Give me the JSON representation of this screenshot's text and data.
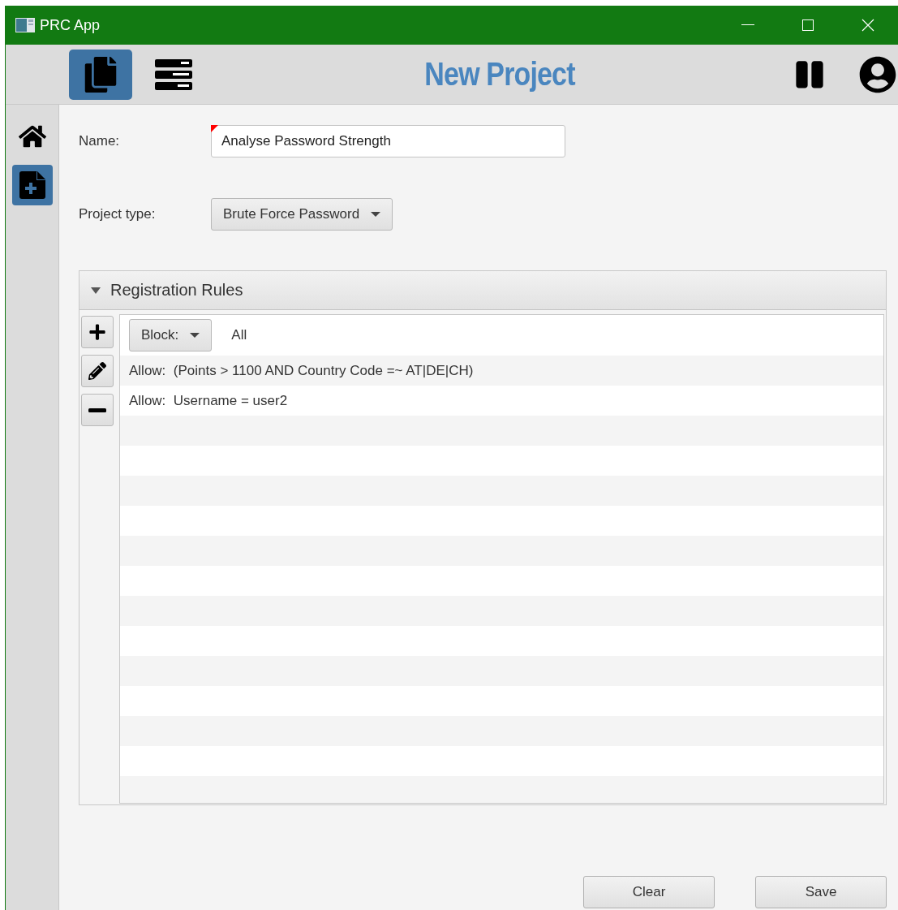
{
  "window": {
    "title": "PRC App"
  },
  "toolbar": {
    "tabs": [
      {
        "kind": "documents",
        "selected": true
      },
      {
        "kind": "list",
        "selected": false
      }
    ],
    "title": "New Project"
  },
  "sidebar": {
    "items": [
      {
        "kind": "home",
        "selected": false
      },
      {
        "kind": "new-project",
        "selected": true
      }
    ]
  },
  "form": {
    "name": {
      "label": "Name:",
      "value": "Analyse Password Strength",
      "flagged": true
    },
    "project_type": {
      "label": "Project type:",
      "value": "Brute Force Password"
    }
  },
  "rules_panel": {
    "title": "Registration Rules",
    "expanded": true,
    "rules": [
      {
        "kind": "default",
        "action": "Block:",
        "value": "All"
      },
      {
        "kind": "rule",
        "text": "Allow:  (Points > 1100 AND Country Code =~ AT|DE|CH)"
      },
      {
        "kind": "rule",
        "text": "Allow:  Username = user2"
      }
    ]
  },
  "buttons": [
    "Clear",
    "Save"
  ]
}
